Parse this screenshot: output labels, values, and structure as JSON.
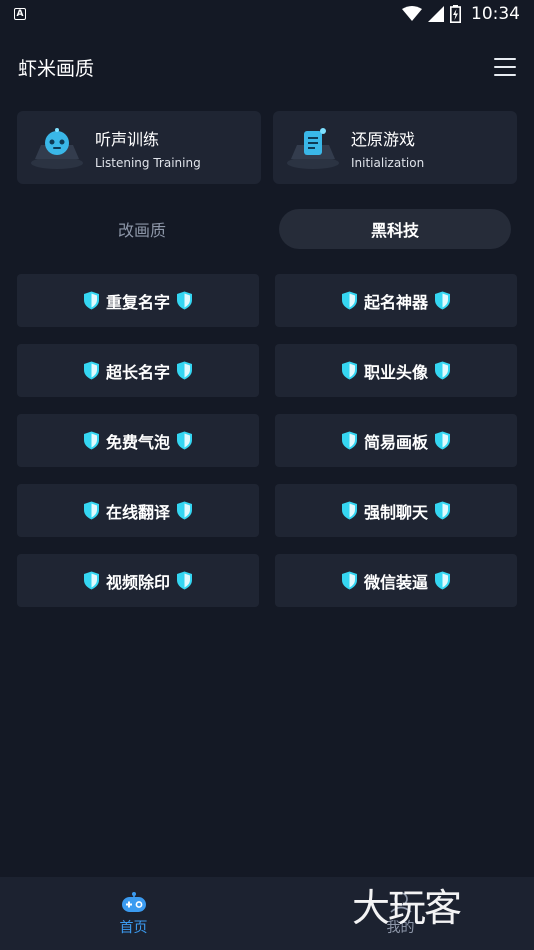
{
  "status_bar": {
    "notification_icon": "a-icon",
    "time": "10:34"
  },
  "app_bar": {
    "title": "虾米画质",
    "menu_icon": "menu-icon"
  },
  "feature_cards": [
    {
      "title": "听声训练",
      "subtitle": "Listening Training",
      "icon": "gamepad-icon"
    },
    {
      "title": "还原游戏",
      "subtitle": "Initialization",
      "icon": "document-icon"
    }
  ],
  "tabs": [
    {
      "label": "改画质",
      "active": false
    },
    {
      "label": "黑科技",
      "active": true
    }
  ],
  "grid_buttons": [
    {
      "label": "重复名字"
    },
    {
      "label": "起名神器"
    },
    {
      "label": "超长名字"
    },
    {
      "label": "职业头像"
    },
    {
      "label": "免费气泡"
    },
    {
      "label": "简易画板"
    },
    {
      "label": "在线翻译"
    },
    {
      "label": "强制聊天"
    },
    {
      "label": "视频除印"
    },
    {
      "label": "微信装逼"
    }
  ],
  "bottom_nav": [
    {
      "label": "首页",
      "active": true,
      "icon": "game-controller-icon"
    },
    {
      "label": "我的",
      "active": false,
      "icon": "person-icon"
    }
  ],
  "watermark": "大玩客",
  "colors": {
    "background": "#141925",
    "card": "#1f2533",
    "accent": "#3b9bf0",
    "shield_cyan": "#35d6f2"
  }
}
